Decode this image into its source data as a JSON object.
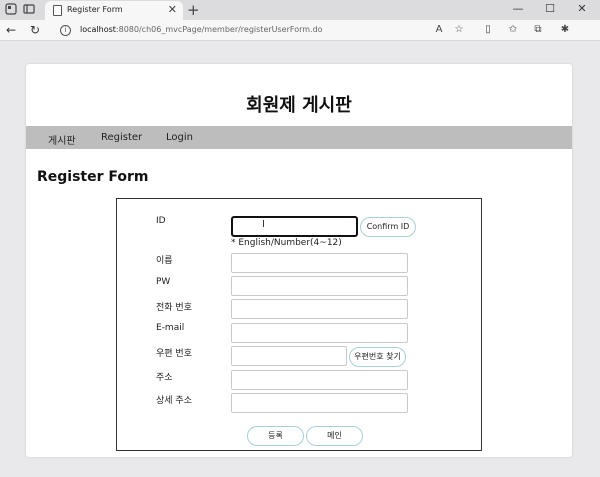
{
  "browser": {
    "tab_title": "Register Form",
    "url_host": "localhost",
    "url_path": ":8080/ch06_mvcPage/member/registerUserForm.do",
    "icons": {
      "workspaces": "workspaces-icon",
      "tab_actions": "tab-actions-icon",
      "close": "✕",
      "new_tab": "+",
      "minimize": "—",
      "maximize": "☐",
      "window_close": "✕",
      "back": "←",
      "refresh": "↻",
      "info": "i",
      "read_aloud": "A",
      "favorite": "☆",
      "split": "▯",
      "favorites": "✩",
      "collections": "⧉",
      "extensions": "✱"
    }
  },
  "site": {
    "title": "회원제 게시판",
    "nav": [
      "게시판",
      "Register",
      "Login"
    ]
  },
  "page": {
    "heading": "Register Form"
  },
  "form": {
    "labels": {
      "id": "ID",
      "name": "이름",
      "pw": "PW",
      "phone": "전화 번호",
      "email": "E-mail",
      "zipcode": "우편 번호",
      "address": "주소",
      "address_detail": "상세 주소"
    },
    "values": {
      "id": "",
      "name": "",
      "pw": "",
      "phone": "",
      "email": "",
      "zipcode": "",
      "address": "",
      "address_detail": ""
    },
    "id_hint": "* English/Number(4~12)",
    "confirm_id_button": "Confirm ID",
    "find_zipcode_button": "우편번호 찾기",
    "submit_button": "등록",
    "main_button": "메인"
  },
  "colors": {
    "page_bg": "#e9e9ec",
    "navbar_bg": "#bdbdbd",
    "button_border": "#a9cfd7"
  }
}
